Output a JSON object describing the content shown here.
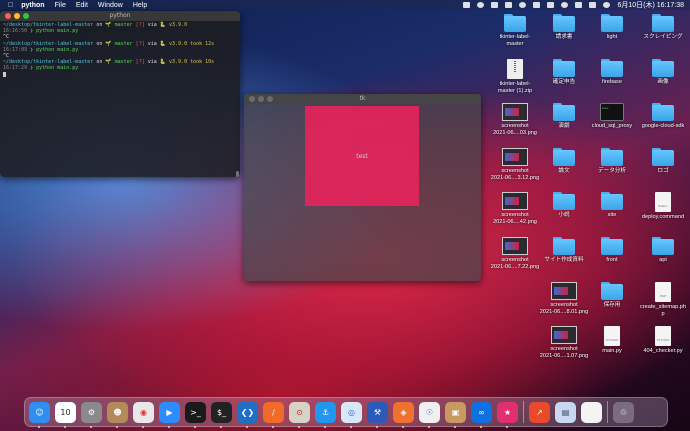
{
  "menubar": {
    "apple_icon": "",
    "app_name": "python",
    "menus": [
      "File",
      "Edit",
      "Window",
      "Help"
    ],
    "datetime": "6月10日(木)  16:17:38",
    "status_icons": [
      "dropbox-icon",
      "record-icon",
      "p-icon",
      "monitor-icon",
      "cpu-icon",
      "bluetooth-icon",
      "battery-icon",
      "wifi-icon",
      "search-icon",
      "control-center-icon",
      "user-icon"
    ]
  },
  "terminal": {
    "title": "python",
    "lines": [
      {
        "path": "~/desktop/tkinter-label-master",
        "on": " on ",
        "branch": "🌱 master",
        "flag": " [?]",
        "via": " via ",
        "py": "🐍 v3.9.0",
        "took": ""
      },
      {
        "time": "16:16:50",
        "cmd": " ❯ python main.py"
      },
      {
        "plain": "^C"
      },
      {
        "path": "~/desktop/tkinter-label-master",
        "on": " on ",
        "branch": "🌱 master",
        "flag": " [?]",
        "via": " via ",
        "py": "🐍 v3.9.0",
        "took": " took 12s"
      },
      {
        "time": "16:17:09",
        "cmd": " ❯ python main.py"
      },
      {
        "plain": "^C"
      },
      {
        "path": "~/desktop/tkinter-label-master",
        "on": " on ",
        "branch": "🌱 master",
        "flag": " [?]",
        "via": " via ",
        "py": "🐍 v3.9.0",
        "took": " took 10s"
      },
      {
        "time": "16:17:29",
        "cmd": " ❯ python main.py"
      }
    ]
  },
  "tk_window": {
    "title": "tk",
    "label_text": "test",
    "label_color": "#e8245c"
  },
  "desktop_items": [
    {
      "name": "tkinter-label-\nmaster",
      "type": "folder"
    },
    {
      "name": "請求書",
      "type": "folder"
    },
    {
      "name": "light",
      "type": "folder"
    },
    {
      "name": "スクレイピング",
      "type": "folder"
    },
    {
      "name": "tkinter-label-\nmaster (1).zip",
      "type": "zip"
    },
    {
      "name": "確定申告",
      "type": "folder"
    },
    {
      "name": "firebase",
      "type": "folder"
    },
    {
      "name": "画像",
      "type": "folder"
    },
    {
      "name": "screenshot\n2021-06....03.png",
      "type": "shot"
    },
    {
      "name": "演劇",
      "type": "folder"
    },
    {
      "name": "cloud_sql_proxy",
      "type": "exec"
    },
    {
      "name": "google-cloud-sdk",
      "type": "folder"
    },
    {
      "name": "screenshot\n2021-06....3.12.png",
      "type": "shot"
    },
    {
      "name": "論文",
      "type": "folder"
    },
    {
      "name": "データ分析",
      "type": "folder"
    },
    {
      "name": "ロゴ",
      "type": "folder"
    },
    {
      "name": "screenshot\n2021-06....42.png",
      "type": "shot"
    },
    {
      "name": "小説",
      "type": "folder"
    },
    {
      "name": "site",
      "type": "folder"
    },
    {
      "name": "deploy.command",
      "type": "doc",
      "doc_label": "SHELL"
    },
    {
      "name": "screenshot\n2021-06....7.22.png",
      "type": "shot"
    },
    {
      "name": "サイト作成資料",
      "type": "folder"
    },
    {
      "name": "front",
      "type": "folder"
    },
    {
      "name": "api",
      "type": "folder"
    },
    {
      "name": "screenshot\n2021-06....8.01.png",
      "type": "shot"
    },
    {
      "name": "保存用",
      "type": "folder"
    },
    {
      "name": "create_sitemap.ph\np",
      "type": "doc",
      "doc_label": "PHP"
    },
    {
      "name": "screenshot\n2021-06....1.07.png",
      "type": "shot"
    },
    {
      "name": "main.py",
      "type": "doc",
      "doc_label": "PYTHON"
    },
    {
      "name": "404_checker.py",
      "type": "doc",
      "doc_label": "PYTHON"
    }
  ],
  "dock": [
    {
      "name": "finder-icon",
      "glyph": "☺",
      "bg": "#2f8ff0"
    },
    {
      "name": "calendar-icon",
      "glyph": "10",
      "bg": "#ffffff",
      "fg": "#222"
    },
    {
      "name": "system-preferences-icon",
      "glyph": "⚙",
      "bg": "#8a8a8a"
    },
    {
      "name": "contacts-icon",
      "glyph": "☻",
      "bg": "#b48a5a"
    },
    {
      "name": "chrome-icon",
      "glyph": "◉",
      "bg": "#e8e8e8",
      "fg": "#d33"
    },
    {
      "name": "zoom-icon",
      "glyph": "▶",
      "bg": "#2d8cff"
    },
    {
      "name": "terminal-icon",
      "glyph": ">_",
      "bg": "#1a1a1a"
    },
    {
      "name": "iterm-icon",
      "glyph": "$_",
      "bg": "#222"
    },
    {
      "name": "vscode-icon",
      "glyph": "❮❯",
      "bg": "#1f6fc7"
    },
    {
      "name": "swift-playgrounds-icon",
      "glyph": "∕",
      "bg": "#f06a2a"
    },
    {
      "name": "sequel-pro-icon",
      "glyph": "⊙",
      "bg": "#d8d2c4",
      "fg": "#a33"
    },
    {
      "name": "docker-icon",
      "glyph": "⚓",
      "bg": "#2396ed"
    },
    {
      "name": "safari-icon",
      "glyph": "◎",
      "bg": "#d8e8f8",
      "fg": "#2a6ad8"
    },
    {
      "name": "sourcetree-icon",
      "glyph": "⚒",
      "bg": "#2c5ab8"
    },
    {
      "name": "git-icon",
      "glyph": "◈",
      "bg": "#f07030"
    },
    {
      "name": "fiddler-icon",
      "glyph": "☉",
      "bg": "#f0f0f0",
      "fg": "#2a6ad8"
    },
    {
      "name": "preview-icon",
      "glyph": "▣",
      "bg": "#c89a60"
    },
    {
      "name": "infinity-icon",
      "glyph": "∞",
      "bg": "#1070e0"
    },
    {
      "name": "reminder-icon",
      "glyph": "★",
      "bg": "#e03070"
    },
    {
      "name": "separator"
    },
    {
      "name": "activity-icon",
      "glyph": "↗",
      "bg": "#e84a2a"
    },
    {
      "name": "image-icon",
      "glyph": "▤",
      "bg": "#c8d8f0",
      "fg": "#345"
    },
    {
      "name": "document-icon",
      "glyph": "",
      "bg": "#f4f4f4"
    },
    {
      "name": "separator"
    },
    {
      "name": "trash-icon",
      "glyph": "♲",
      "bg": "rgba(200,200,210,0.35)"
    }
  ]
}
